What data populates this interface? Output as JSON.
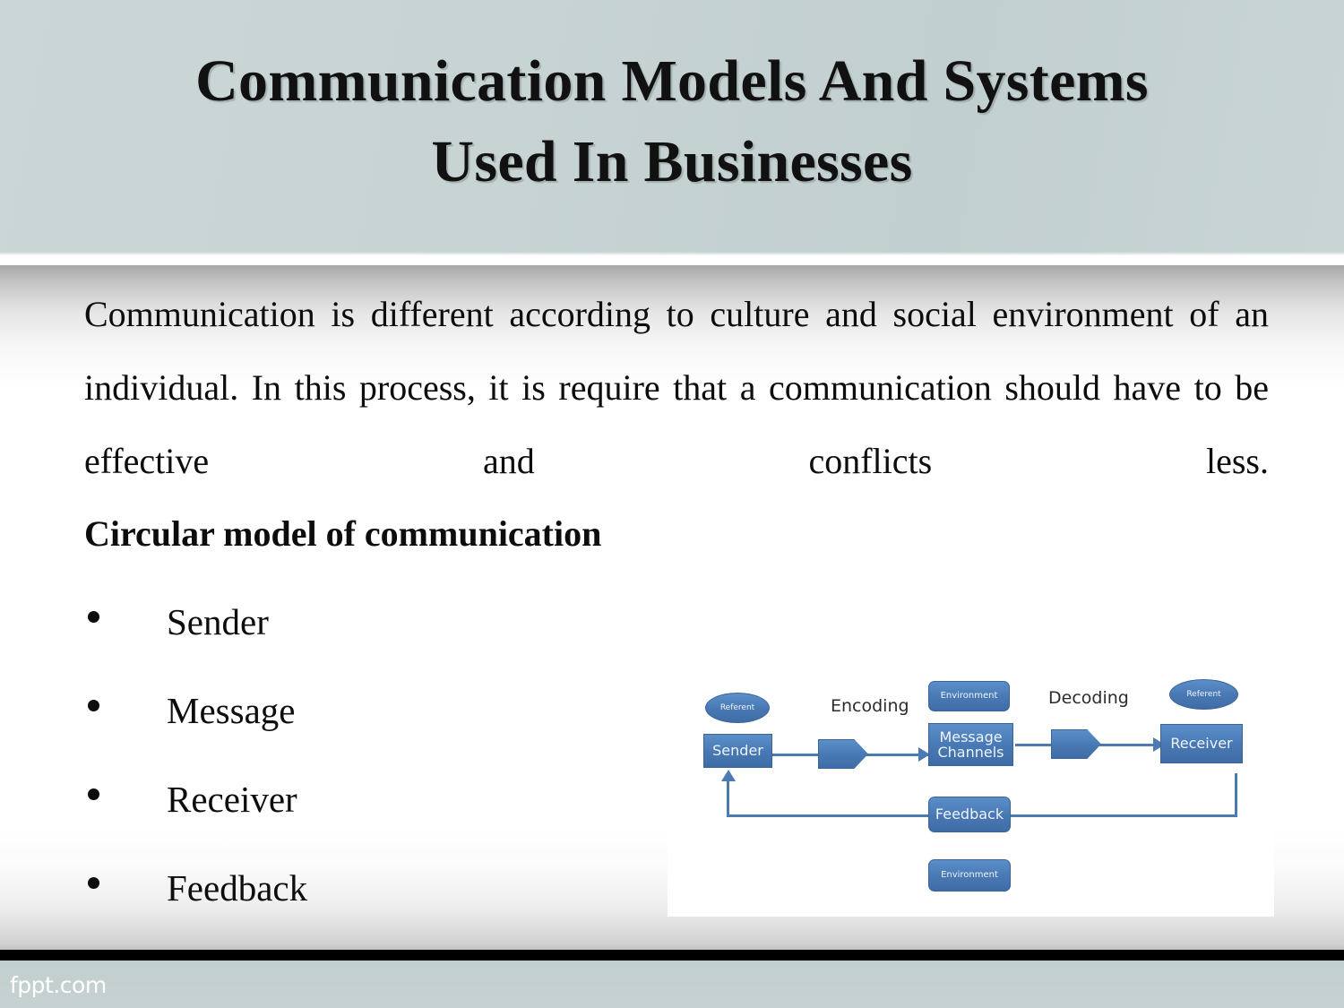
{
  "slide": {
    "title_lines": [
      "Communication Models And Systems",
      "Used In Businesses"
    ],
    "paragraph": "Communication is different according to culture and social environment of an individual. In this process, it is require that a communication should have to be effective and conflicts less.",
    "subheading": "Circular model of communication",
    "bullets": [
      {
        "label": "Sender"
      },
      {
        "label": "Message"
      },
      {
        "label": "Receiver"
      },
      {
        "label": "Feedback"
      }
    ]
  },
  "diagram": {
    "nodes": {
      "referent_left": "Referent",
      "sender": "Sender",
      "environment_top": "Environment",
      "message_channels": "Message\nChannels",
      "message_channels_line1": "Message",
      "message_channels_line2": "Channels",
      "referent_right": "Referent",
      "receiver": "Receiver",
      "feedback": "Feedback",
      "environment_bottom": "Environment"
    },
    "labels": {
      "encoding": "Encoding",
      "decoding": "Decoding"
    }
  },
  "footer": {
    "logo": "fppt.com"
  },
  "colors": {
    "header_band": "#c8d4d4",
    "diagram_blue": "#4878b3",
    "diagram_blue_border": "#3a6599",
    "diagram_line": "#4b7bb0",
    "text": "#0d0d0d",
    "footer_bar": "#000000",
    "footer_band": "#c4d1d1",
    "footer_logo_text": "#ffffff"
  }
}
